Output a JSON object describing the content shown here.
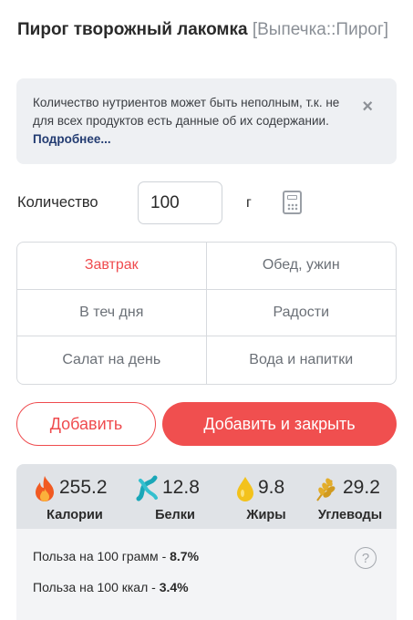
{
  "product": {
    "name": "Пирог творожный лакомка",
    "category": "[Выпечка::Пирог]"
  },
  "notice": {
    "text": "Количество нутриентов может быть неполным, т.к. не для всех продуктов есть данные об их содержании.",
    "link": "Подробнее...",
    "close": "×"
  },
  "quantity": {
    "label": "Количество",
    "value": "100",
    "unit": "г"
  },
  "meals": [
    {
      "label": "Завтрак",
      "active": true
    },
    {
      "label": "Обед, ужин",
      "active": false
    },
    {
      "label": "В теч дня",
      "active": false
    },
    {
      "label": "Радости",
      "active": false
    },
    {
      "label": "Салат на день",
      "active": false
    },
    {
      "label": "Вода и напитки",
      "active": false
    }
  ],
  "actions": {
    "add": "Добавить",
    "add_close": "Добавить и закрыть"
  },
  "nutrients": [
    {
      "value": "255.2",
      "label": "Калории",
      "icon": "fire-icon"
    },
    {
      "value": "12.8",
      "label": "Белки",
      "icon": "protein-icon"
    },
    {
      "value": "9.8",
      "label": "Жиры",
      "icon": "fat-drop-icon"
    },
    {
      "value": "29.2",
      "label": "Углеводы",
      "icon": "wheat-icon"
    }
  ],
  "benefit": {
    "per_100g_label": "Польза на 100 грамм - ",
    "per_100g_value": "8.7%",
    "per_100kcal_label": "Польза на 100 ккал - ",
    "per_100kcal_value": "3.4%",
    "help": "?"
  },
  "colors": {
    "accent": "#ef4b4e",
    "link": "#233c72",
    "panel": "#e0e3e7"
  }
}
